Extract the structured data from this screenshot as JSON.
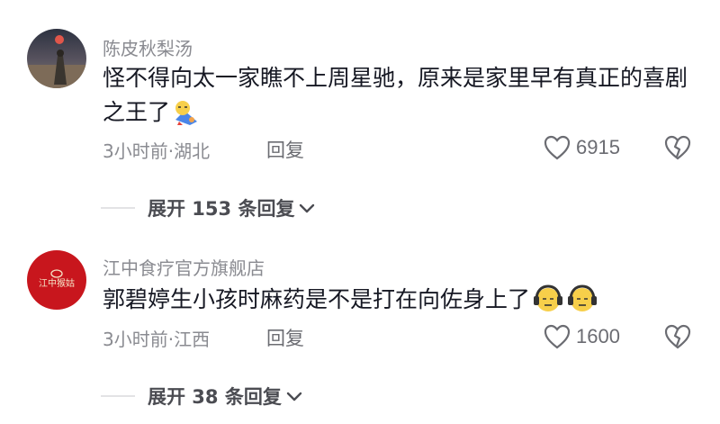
{
  "comments": [
    {
      "username": "陈皮秋梨汤",
      "text": "怪不得向太一家瞧不上周星驰，原来是家里早有真正的喜剧之王了",
      "emojis": [
        "sleepy-character-emoji"
      ],
      "time_location": "3小时前·湖北",
      "reply_label": "回复",
      "likes": "6915",
      "expand_label": "展开 153 条回复"
    },
    {
      "username": "江中食疗官方旗舰店",
      "avatar_text": "江中猴姑",
      "text": "郭碧婷生小孩时麻药是不是打在向佐身上了",
      "emojis": [
        "headphone-face-emoji",
        "headphone-face-emoji"
      ],
      "time_location": "3小时前·江西",
      "reply_label": "回复",
      "likes": "1600",
      "expand_label": "展开 38 条回复"
    }
  ],
  "colors": {
    "text": "#161823",
    "secondary": "#8a8b91",
    "brand_red": "#c8161d",
    "divider": "#e3e3e5"
  }
}
